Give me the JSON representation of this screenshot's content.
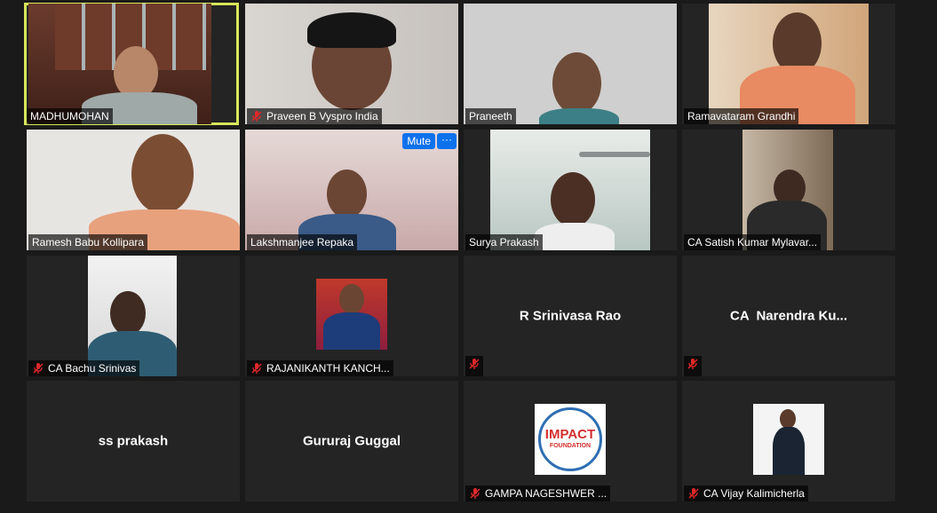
{
  "participants": [
    {
      "name": "MADHUMOHAN",
      "muted": false
    },
    {
      "name": "Praveen B Vyspro India",
      "muted": true
    },
    {
      "name": "Praneeth",
      "muted": false
    },
    {
      "name": "Ramavataram Grandhi",
      "muted": false
    },
    {
      "name": "Ramesh Babu Kollipara",
      "muted": false
    },
    {
      "name": "Lakshmanjee Repaka",
      "muted": false
    },
    {
      "name": "Surya Prakash",
      "muted": false
    },
    {
      "name": "CA Satish Kumar Mylavar...",
      "muted": false
    },
    {
      "name": "CA Bachu Srinivas",
      "muted": true
    },
    {
      "name": "RAJANIKANTH KANCH...",
      "muted": true
    },
    {
      "name": "R Srinivasa Rao",
      "muted": true
    },
    {
      "name": "CA  Narendra Ku...",
      "muted": true
    },
    {
      "name": "ss prakash",
      "muted": false
    },
    {
      "name": "Gururaj Guggal",
      "muted": false
    },
    {
      "name": "GAMPA NAGESHWER ...",
      "muted": true
    },
    {
      "name": "CA Vijay Kalimicherla",
      "muted": true
    }
  ],
  "hover_controls": {
    "mute_label": "Mute",
    "more_label": "···"
  },
  "impact_logo": {
    "line1": "IMPACT",
    "line2": "FOUNDATION"
  },
  "colors": {
    "active_border": "#d7e65a",
    "button_blue": "#0e72ed",
    "mute_red": "#e02828"
  }
}
